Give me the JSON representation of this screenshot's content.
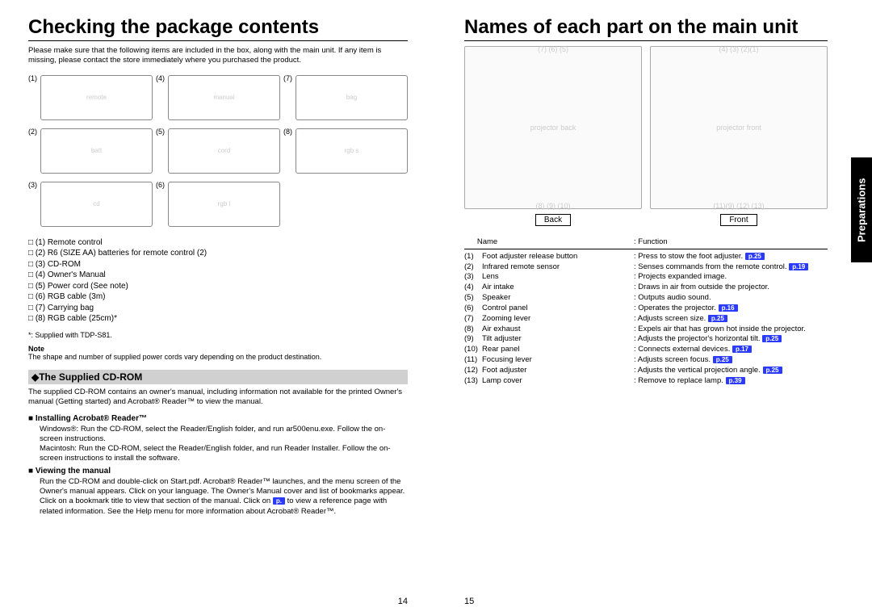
{
  "left": {
    "title": "Checking the package contents",
    "intro": "Please make sure that the following items are included in the box, along with the main unit. If any item is missing, please contact the store immediately where you purchased the product.",
    "items": [
      "(1)  Remote control",
      "(2)  R6 (SIZE AA) batteries for remote control (2)",
      "(3)  CD-ROM",
      "(4)  Owner's Manual",
      "(5)  Power cord (See note)",
      "(6)  RGB cable (3m)",
      "(7)  Carrying bag",
      "(8)  RGB cable (25cm)*"
    ],
    "supplied_note": "*: Supplied with TDP-S81.",
    "note_h": "Note",
    "note_t": "The shape and number of supplied power cords vary depending on the product destination.",
    "cdrom_h": "◆The Supplied CD-ROM",
    "cdrom_body": "The supplied CD-ROM contains an owner's manual, including information not available for the printed Owner's manual (Getting started) and Acrobat® Reader™ to view the manual.",
    "install_h": "Installing Acrobat® Reader™",
    "install_body1": "Windows®: Run the CD-ROM, select the Reader/English folder, and run ar500enu.exe. Follow the on-screen instructions.",
    "install_body2": "Macintosh: Run the CD-ROM, select the Reader/English folder, and run Reader Installer. Follow the on-screen instructions to install the software.",
    "view_h": "Viewing the manual",
    "view_body1": "Run the CD-ROM and double-click on Start.pdf. Acrobat® Reader™ launches, and the menu screen of the Owner's manual appears. Click on your language. The Owner's Manual cover and list of bookmarks appear. Click on a bookmark title to view that section of the manual. Click on ",
    "view_body2": " to view a reference page with related information. See the Help menu for more information about Acrobat® Reader™.",
    "pref_inline": "p.",
    "pagenum": "14"
  },
  "right": {
    "title": "Names of each part on the main unit",
    "sidebar": "Preparations",
    "view_back": "Back",
    "view_front": "Front",
    "back_top": "(7)  (6)        (5)",
    "back_bot": "(8)     (9)        (10)",
    "front_top": "(4)            (3)  (2)(1)",
    "front_bot": "(11)(9)  (12)  (13)",
    "col_name": "Name",
    "col_func": ": Function",
    "rows": [
      {
        "idx": "(1)",
        "name": "Foot adjuster release button",
        "func": "Press to stow the foot adjuster.",
        "pref": "p.25"
      },
      {
        "idx": "(2)",
        "name": "Infrared remote sensor",
        "func": "Senses commands from the remote control.",
        "pref": "p.19"
      },
      {
        "idx": "(3)",
        "name": "Lens",
        "func": "Projects expanded image.",
        "pref": ""
      },
      {
        "idx": "(4)",
        "name": "Air intake",
        "func": "Draws in air from outside the projector.",
        "pref": ""
      },
      {
        "idx": "(5)",
        "name": "Speaker",
        "func": "Outputs audio sound.",
        "pref": ""
      },
      {
        "idx": "(6)",
        "name": "Control panel",
        "func": "Operates the projector.",
        "pref": "p.16"
      },
      {
        "idx": "(7)",
        "name": "Zooming lever",
        "func": "Adjusts screen size.",
        "pref": "p.25"
      },
      {
        "idx": "(8)",
        "name": "Air exhaust",
        "func": "Expels air that has grown hot inside the projector.",
        "pref": ""
      },
      {
        "idx": "(9)",
        "name": "Tilt adjuster",
        "func": "Adjusts the projector's horizontal tilt.",
        "pref": "p.25"
      },
      {
        "idx": "(10)",
        "name": "Rear panel",
        "func": "Connects external devices.",
        "pref": "p.17"
      },
      {
        "idx": "(11)",
        "name": "Focusing lever",
        "func": "Adjusts screen focus.",
        "pref": "p.25"
      },
      {
        "idx": "(12)",
        "name": "Foot adjuster",
        "func": "Adjusts the vertical projection angle.",
        "pref": "p.25"
      },
      {
        "idx": "(13)",
        "name": "Lamp cover",
        "func": "Remove to replace lamp.",
        "pref": "p.39"
      }
    ],
    "pagenum": "15"
  }
}
